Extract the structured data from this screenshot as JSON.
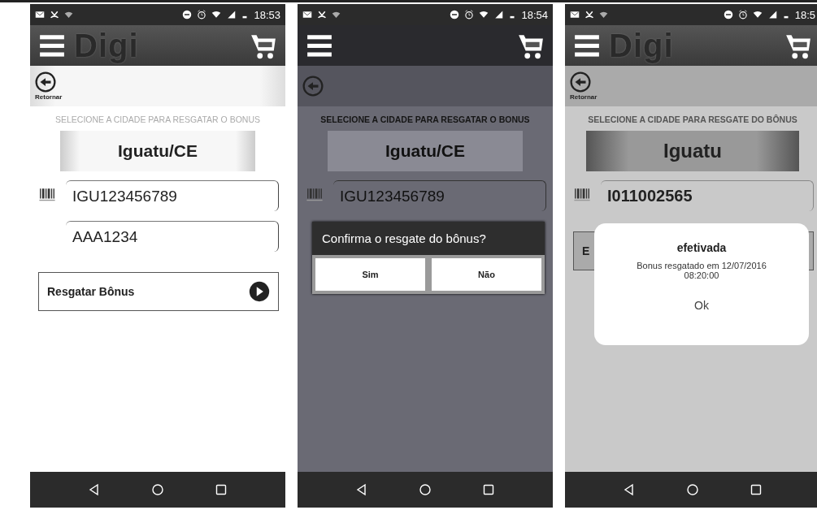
{
  "phones": [
    {
      "time": "18:53",
      "logo": "Digi",
      "back_label": "Retornar",
      "instruction": "SELECIONE A CIDADE PARA RESGATAR O BONUS",
      "city": "Iguatu/CE",
      "fields": [
        {
          "value": "IGU123456789",
          "barcode": true
        },
        {
          "value": "AAA1234",
          "barcode": false
        }
      ],
      "button": {
        "label": "Resgatar Bônus"
      }
    },
    {
      "time": "18:54",
      "instruction": "SELECIONE A CIDADE PARA RESGATAR O BONUS",
      "city": "Iguatu/CE",
      "fields": [
        {
          "value": "IGU123456789",
          "barcode": true
        }
      ],
      "dialog": {
        "kind": "confirm",
        "message": "Confirma o resgate do bônus?",
        "buttons": [
          "Sim",
          "Não"
        ]
      }
    },
    {
      "time": "18:5",
      "logo": "Digi",
      "back_label": "Retornar",
      "instruction": "SELECIONE A CIDADE PARA RESGATE DO BÔNUS",
      "city": "Iguatu",
      "fields": [
        {
          "value": "I011002565",
          "barcode": true
        }
      ],
      "button": {
        "label": "E"
      },
      "dialog": {
        "kind": "alert",
        "title": "efetivada",
        "message": "Bonus resgatado em 12/07/2016 08:20:00",
        "buttons": [
          "Ok"
        ]
      }
    }
  ]
}
